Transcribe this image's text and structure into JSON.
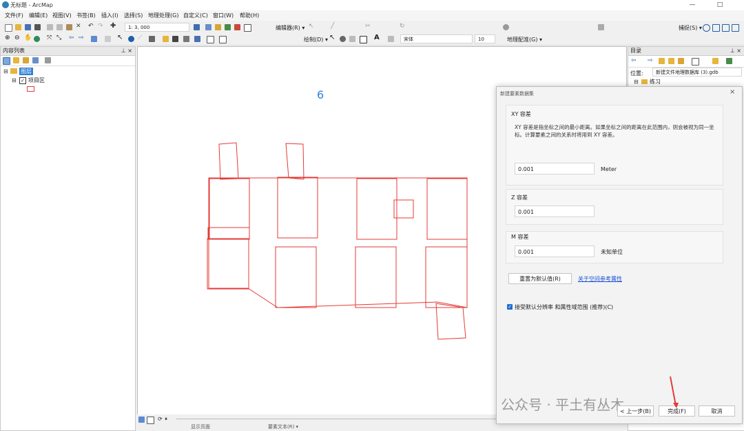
{
  "window": {
    "title": "无标题 - ArcMap",
    "minimize": "—",
    "maximize": "□"
  },
  "menu": [
    "文件(F)",
    "编辑(E)",
    "视图(V)",
    "书签(B)",
    "插入(I)",
    "选择(S)",
    "地理处理(G)",
    "自定义(C)",
    "窗口(W)",
    "帮助(H)"
  ],
  "toolbar": {
    "scale": "1: 3, 000",
    "editor": "编辑器(R) ▾",
    "snapping": "捕捉(S) ▾",
    "draw": "绘制(D) ▾",
    "font": "宋体",
    "font_size": "10",
    "georef": "地理配准(G) ▾"
  },
  "toc": {
    "title": "内容列表",
    "pin": "⊥ ×",
    "layers_group": "图层",
    "layer": "项目区"
  },
  "map": {
    "annotation_number": "6"
  },
  "catalog": {
    "title": "目录",
    "pin": "⊥ ×",
    "location_label": "位置:",
    "location_value": "新建文件地理数据库 (3).gdb",
    "tree_item": "练习"
  },
  "dialog": {
    "title": "新建要素数据集",
    "close": "×",
    "xy_title": "XY 容差",
    "xy_desc": "XY 容差是指坐标之间的最小距离。如果坐标之间的距离在此范围内，则会被视为同一坐标。计算要素之间的关系时将用到 XY 容差。",
    "xy_value": "0.001",
    "xy_unit": "Meter",
    "z_title": "Z 容差",
    "z_value": "0.001",
    "m_title": "M 容差",
    "m_value": "0.001",
    "m_unit": "未知单位",
    "reset_button": "重置为默认值(R)",
    "about_link": "关于空间参考属性",
    "accept_checkbox": "接受默认分辨率 和属性域范围 (推荐)(C)",
    "back_button": "< 上一步(B)",
    "finish_button": "完成(F)",
    "cancel_button": "取消"
  },
  "status": {
    "left_tab": "显示页面",
    "right_tab": "要素文本(R) ▾"
  },
  "watermark": "公众号 · 平土有丛木"
}
